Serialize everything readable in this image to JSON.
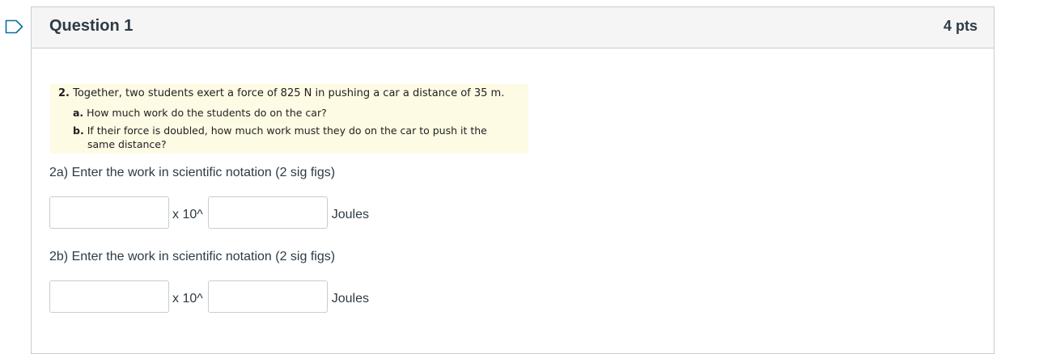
{
  "question": {
    "title": "Question 1",
    "points": "4 pts"
  },
  "problem_image": {
    "number": "2.",
    "main_text": "Together, two students exert a force of 825 N in pushing a car a distance of 35 m.",
    "part_a_label": "a.",
    "part_a_text": "How much work do the students do on the car?",
    "part_b_label": "b.",
    "part_b_text": "If their force is doubled, how much work must they do on the car to push it the",
    "part_b_cont": "same distance?"
  },
  "part_a": {
    "prompt": "2a) Enter the work in scientific notation (2 sig figs)",
    "coefficient_value": "",
    "times_label": "x 10^",
    "exponent_value": "",
    "unit": "Joules"
  },
  "part_b": {
    "prompt": "2b) Enter the work in scientific notation (2 sig figs)",
    "coefficient_value": "",
    "times_label": "x 10^",
    "exponent_value": "",
    "unit": "Joules"
  },
  "colors": {
    "flag": "#0770a3",
    "header_bg": "#f5f5f5",
    "border": "#c7cdd1",
    "text": "#2d3b45",
    "image_bg": "#fdfbe4"
  }
}
